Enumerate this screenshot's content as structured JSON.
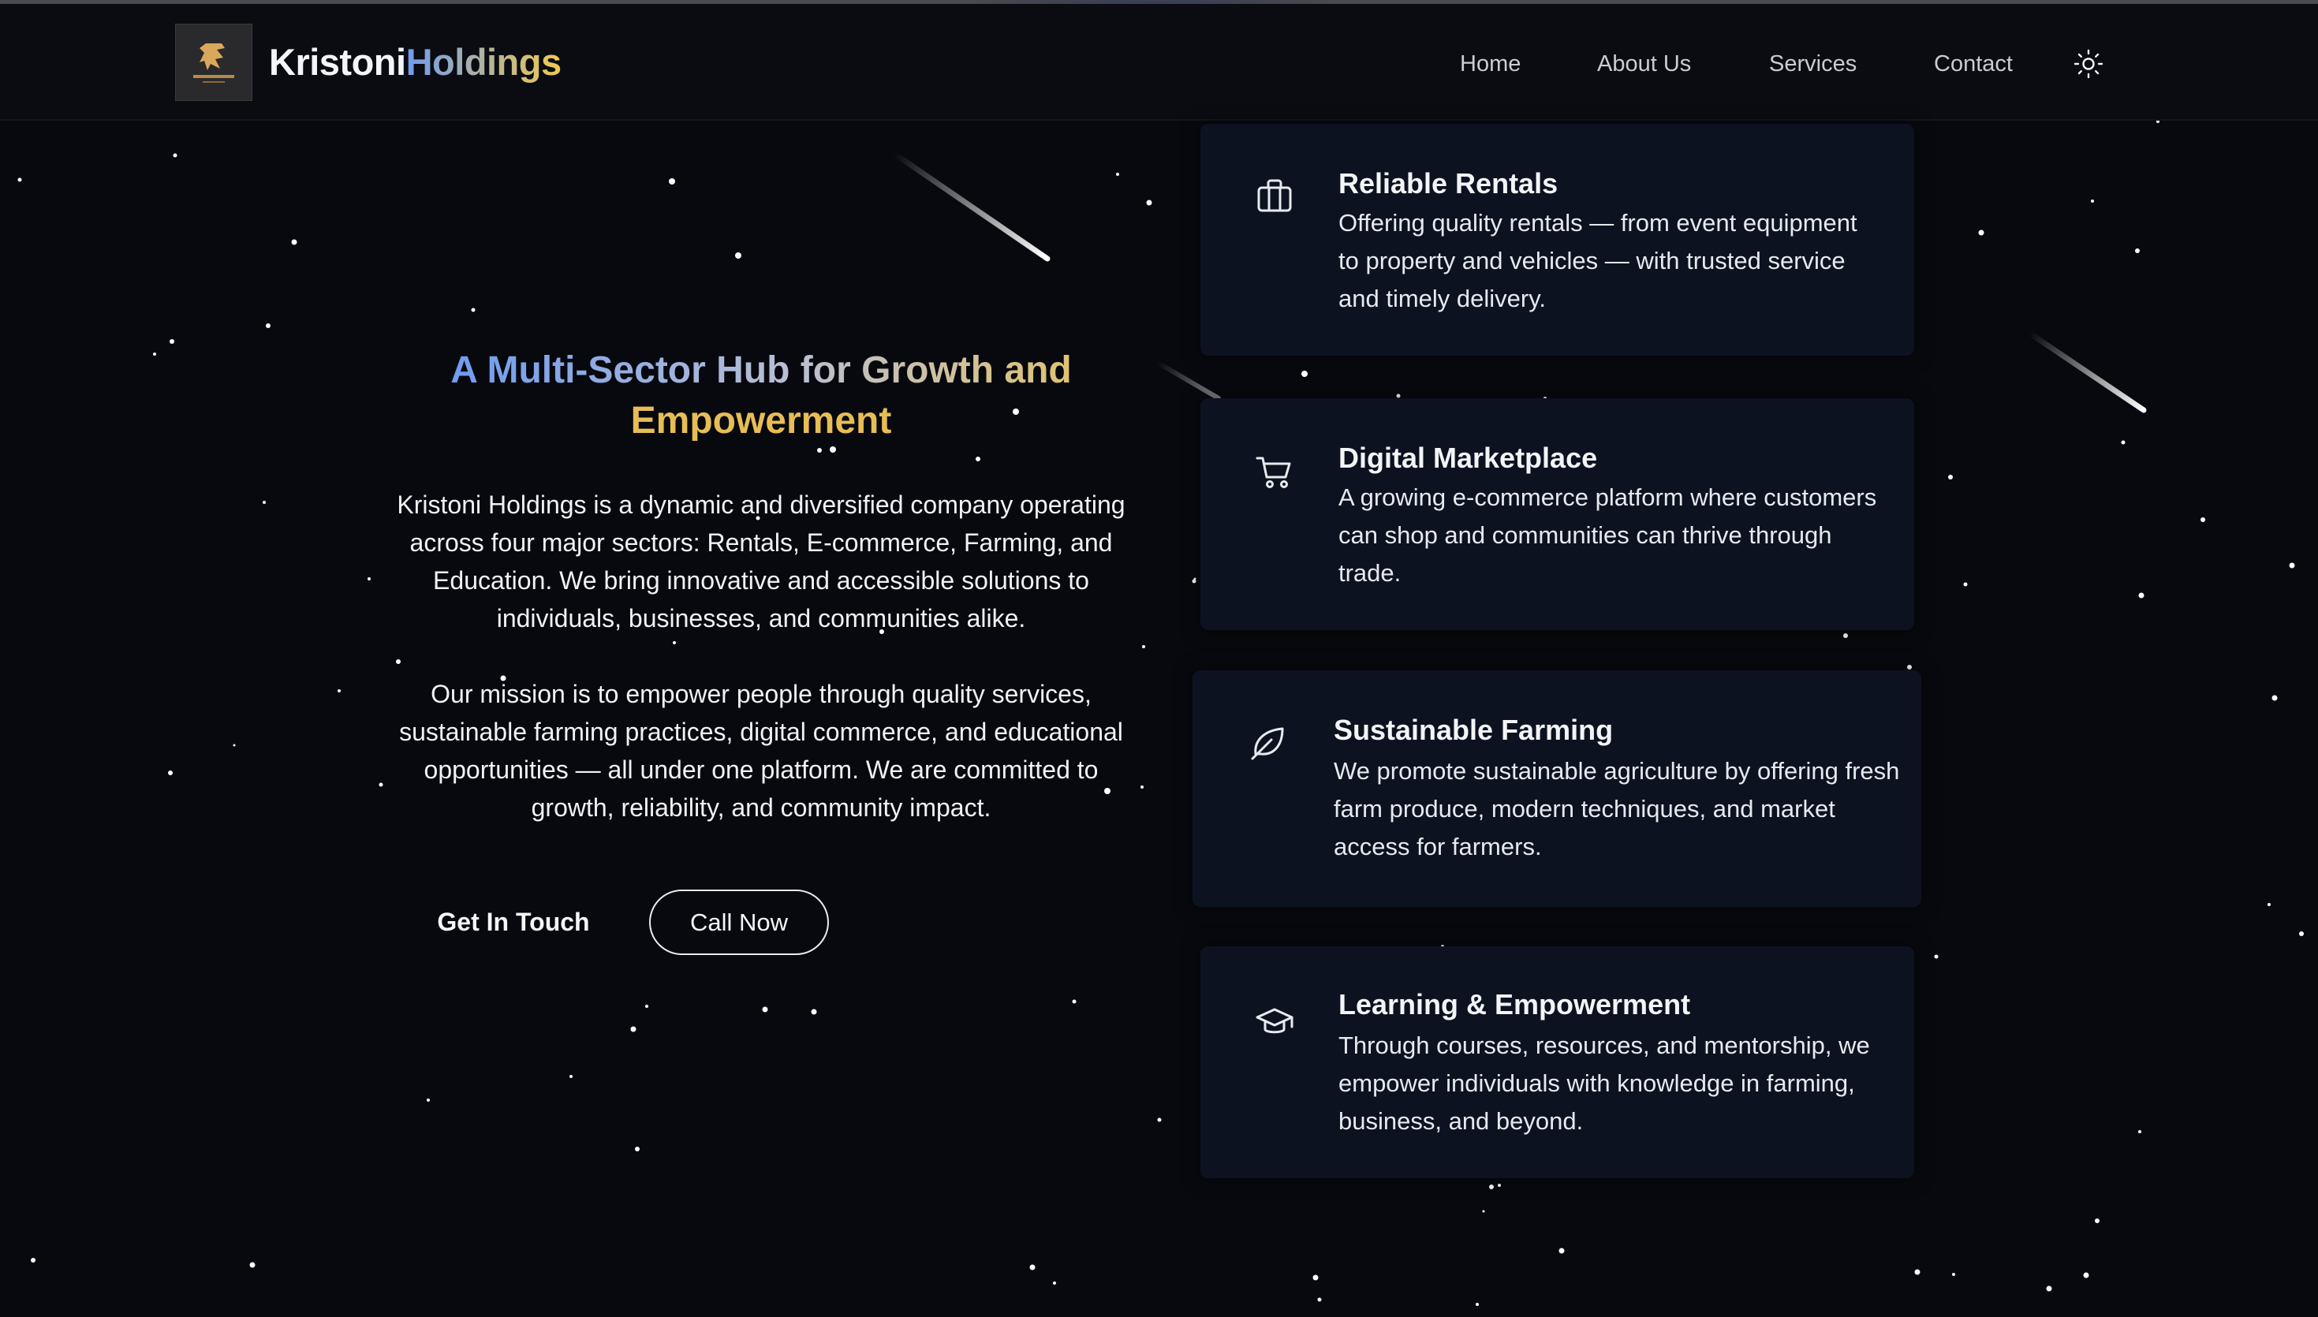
{
  "header": {
    "brand": {
      "part1": "Kristoni",
      "part2": "Holdings"
    },
    "nav": [
      "Home",
      "About Us",
      "Services",
      "Contact"
    ],
    "theme_toggle_icon": "sun-icon"
  },
  "hero": {
    "title_line1": "A Multi-Sector Hub for Growth and",
    "title_line2": "Empowerment",
    "paragraph1": "Kristoni Holdings is a dynamic and diversified company operating across four major sectors: Rentals, E-commerce, Farming, and Education. We bring innovative and accessible solutions to individuals, businesses, and communities alike.",
    "paragraph2": "Our mission is to empower people through quality services, sustainable farming practices, digital commerce, and educational opportunities — all under one platform. We are committed to growth, reliability, and community impact.",
    "primary_button": "Get In Touch",
    "secondary_button": "Call Now"
  },
  "services": [
    {
      "icon": "briefcase-icon",
      "title": "Reliable Rentals",
      "description": "Offering quality rentals — from event equipment to property and vehicles — with trusted service and timely delivery."
    },
    {
      "icon": "shopping-cart-icon",
      "title": "Digital Marketplace",
      "description": "A growing e-commerce platform where customers can shop and communities can thrive through trade."
    },
    {
      "icon": "leaf-icon",
      "title": "Sustainable Farming",
      "description": "We promote sustainable agriculture by offering fresh farm produce, modern techniques, and market access for farmers."
    },
    {
      "icon": "graduation-cap-icon",
      "title": "Learning & Empowerment",
      "description": "Through courses, resources, and mentorship, we empower individuals with knowledge in farming, business, and beyond."
    }
  ],
  "colors": {
    "background": "#08090e",
    "card": "#0d1220",
    "accent_blue": "#6f9cf0",
    "accent_gold": "#e7bd55"
  }
}
